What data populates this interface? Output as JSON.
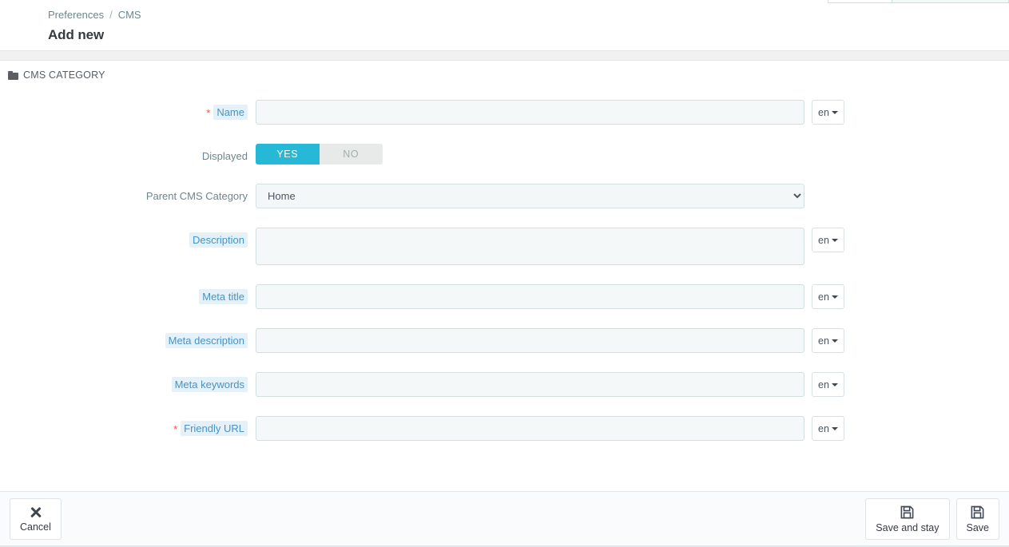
{
  "topbar": {
    "cut_off_search_placeholder": ""
  },
  "header": {
    "breadcrumb": [
      {
        "label": "Preferences",
        "name": "breadcrumb-preferences"
      },
      {
        "label": "CMS",
        "name": "breadcrumb-cms"
      }
    ],
    "separator": "/",
    "title": "Add new"
  },
  "panel": {
    "icon": "folder-icon",
    "heading": "CMS CATEGORY"
  },
  "form": {
    "rows": [
      {
        "key": "name",
        "label": "Name",
        "required": true,
        "highlight": true,
        "control": "text",
        "value": "",
        "placeholder": "",
        "lang": "en"
      },
      {
        "key": "displayed",
        "label": "Displayed",
        "required": false,
        "highlight": false,
        "control": "switch",
        "on_label": "YES",
        "off_label": "NO",
        "value": "YES"
      },
      {
        "key": "parent_cms_category",
        "label": "Parent CMS Category",
        "required": false,
        "highlight": false,
        "control": "select",
        "value": "Home",
        "options": [
          "Home"
        ]
      },
      {
        "key": "description",
        "label": "Description",
        "required": false,
        "highlight": true,
        "control": "textarea",
        "value": "",
        "placeholder": "",
        "lang": "en"
      },
      {
        "key": "meta_title",
        "label": "Meta title",
        "required": false,
        "highlight": true,
        "control": "text",
        "value": "",
        "placeholder": "",
        "lang": "en"
      },
      {
        "key": "meta_description",
        "label": "Meta description",
        "required": false,
        "highlight": true,
        "control": "text",
        "value": "",
        "placeholder": "",
        "lang": "en"
      },
      {
        "key": "meta_keywords",
        "label": "Meta keywords",
        "required": false,
        "highlight": true,
        "control": "text",
        "value": "",
        "placeholder": "",
        "lang": "en"
      },
      {
        "key": "friendly_url",
        "label": "Friendly URL",
        "required": true,
        "highlight": true,
        "control": "text",
        "value": "",
        "placeholder": "",
        "lang": "en"
      }
    ],
    "required_marker": "*"
  },
  "footer": {
    "cancel_label": "Cancel",
    "save_and_stay_label": "Save and stay",
    "save_label": "Save"
  },
  "colors": {
    "switch_on": "#25b9d7",
    "switch_off": "#e8eaea",
    "label_highlight_bg": "#e4f1f9",
    "label_highlight_fg": "#4893c4",
    "required_star": "#f0513f",
    "input_bg": "#f5f8f8",
    "breadcrumb_fg": "#6c868e"
  }
}
